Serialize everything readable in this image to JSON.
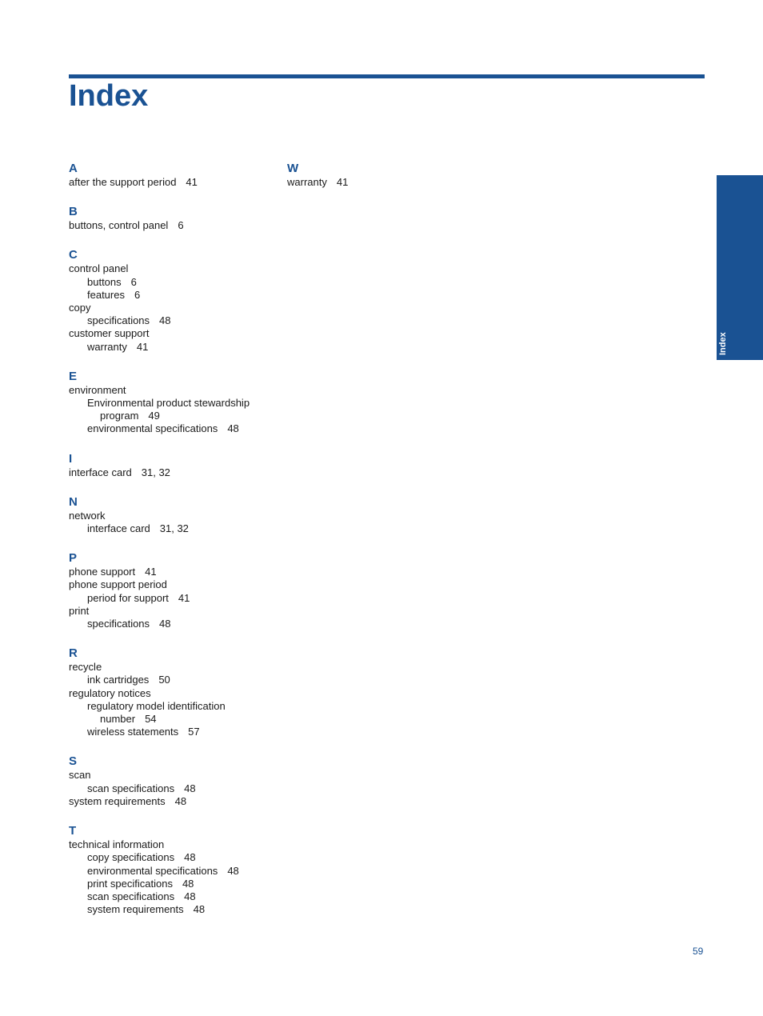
{
  "title": "Index",
  "side_tab": "Index",
  "page_number": "59",
  "colors": {
    "accent": "#1a5293"
  },
  "columns": [
    [
      {
        "letter": "A",
        "entries": [
          {
            "level": 1,
            "text": "after the support period",
            "pages": "41"
          }
        ]
      },
      {
        "letter": "B",
        "entries": [
          {
            "level": 1,
            "text": "buttons, control panel",
            "pages": "6"
          }
        ]
      },
      {
        "letter": "C",
        "entries": [
          {
            "level": 1,
            "text": "control panel",
            "pages": ""
          },
          {
            "level": 2,
            "text": "buttons",
            "pages": "6"
          },
          {
            "level": 2,
            "text": "features",
            "pages": "6"
          },
          {
            "level": 1,
            "text": "copy",
            "pages": ""
          },
          {
            "level": 2,
            "text": "specifications",
            "pages": "48"
          },
          {
            "level": 1,
            "text": "customer support",
            "pages": ""
          },
          {
            "level": 2,
            "text": "warranty",
            "pages": "41"
          }
        ]
      },
      {
        "letter": "E",
        "entries": [
          {
            "level": 1,
            "text": "environment",
            "pages": ""
          },
          {
            "level": 2,
            "text": "Environmental product stewardship",
            "pages": ""
          },
          {
            "level": 3,
            "text": "program",
            "pages": "49"
          },
          {
            "level": 2,
            "text": "environmental specifications",
            "pages": "48"
          }
        ]
      },
      {
        "letter": "I",
        "entries": [
          {
            "level": 1,
            "text": "interface card",
            "pages": "31, 32"
          }
        ]
      },
      {
        "letter": "N",
        "entries": [
          {
            "level": 1,
            "text": "network",
            "pages": ""
          },
          {
            "level": 2,
            "text": "interface card",
            "pages": "31, 32"
          }
        ]
      },
      {
        "letter": "P",
        "entries": [
          {
            "level": 1,
            "text": "phone support",
            "pages": "41"
          },
          {
            "level": 1,
            "text": "phone support period",
            "pages": ""
          },
          {
            "level": 2,
            "text": "period for support",
            "pages": "41"
          },
          {
            "level": 1,
            "text": "print",
            "pages": ""
          },
          {
            "level": 2,
            "text": "specifications",
            "pages": "48"
          }
        ]
      },
      {
        "letter": "R",
        "entries": [
          {
            "level": 1,
            "text": "recycle",
            "pages": ""
          },
          {
            "level": 2,
            "text": "ink cartridges",
            "pages": "50"
          },
          {
            "level": 1,
            "text": "regulatory notices",
            "pages": ""
          },
          {
            "level": 2,
            "text": "regulatory model identification",
            "pages": ""
          },
          {
            "level": 3,
            "text": "number",
            "pages": "54"
          },
          {
            "level": 2,
            "text": "wireless statements",
            "pages": "57"
          }
        ]
      },
      {
        "letter": "S",
        "entries": [
          {
            "level": 1,
            "text": "scan",
            "pages": ""
          },
          {
            "level": 2,
            "text": "scan specifications",
            "pages": "48"
          },
          {
            "level": 1,
            "text": "system requirements",
            "pages": "48"
          }
        ]
      },
      {
        "letter": "T",
        "entries": [
          {
            "level": 1,
            "text": "technical information",
            "pages": ""
          },
          {
            "level": 2,
            "text": "copy specifications",
            "pages": "48"
          },
          {
            "level": 2,
            "text": "environmental specifications",
            "pages": "48"
          },
          {
            "level": 2,
            "text": "print specifications",
            "pages": "48"
          },
          {
            "level": 2,
            "text": "scan specifications",
            "pages": "48"
          },
          {
            "level": 2,
            "text": "system requirements",
            "pages": "48"
          }
        ]
      }
    ],
    [
      {
        "letter": "W",
        "entries": [
          {
            "level": 1,
            "text": "warranty",
            "pages": "41"
          }
        ]
      }
    ]
  ]
}
